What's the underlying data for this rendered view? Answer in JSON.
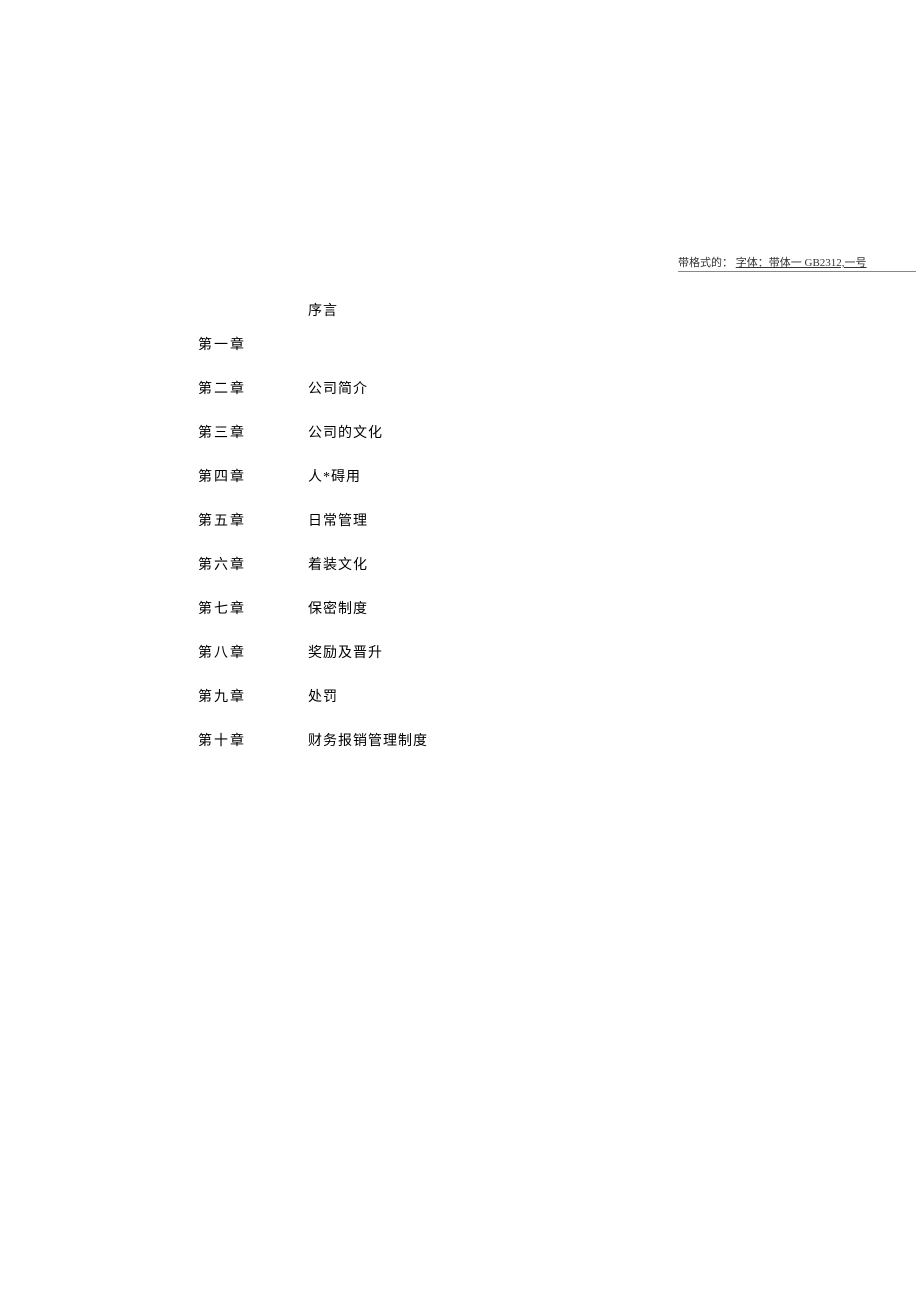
{
  "annotation": {
    "label": "带格式的：",
    "text": "字体：带体一 GB2312,一号"
  },
  "toc": {
    "header": "序言",
    "rows": [
      {
        "chapter": "第一章",
        "title": ""
      },
      {
        "chapter": "第二章",
        "title": "公司简介"
      },
      {
        "chapter": "第三章",
        "title": "公司的文化"
      },
      {
        "chapter": "第四章",
        "title": "人*碍用"
      },
      {
        "chapter": "第五章",
        "title": "日常管理"
      },
      {
        "chapter": "第六章",
        "title": "着装文化"
      },
      {
        "chapter": "第七章",
        "title": "保密制度"
      },
      {
        "chapter": "第八章",
        "title": "奖励及晋升"
      },
      {
        "chapter": "第九章",
        "title": "处罚"
      },
      {
        "chapter": "第十章",
        "title": "财务报销管理制度"
      }
    ]
  }
}
